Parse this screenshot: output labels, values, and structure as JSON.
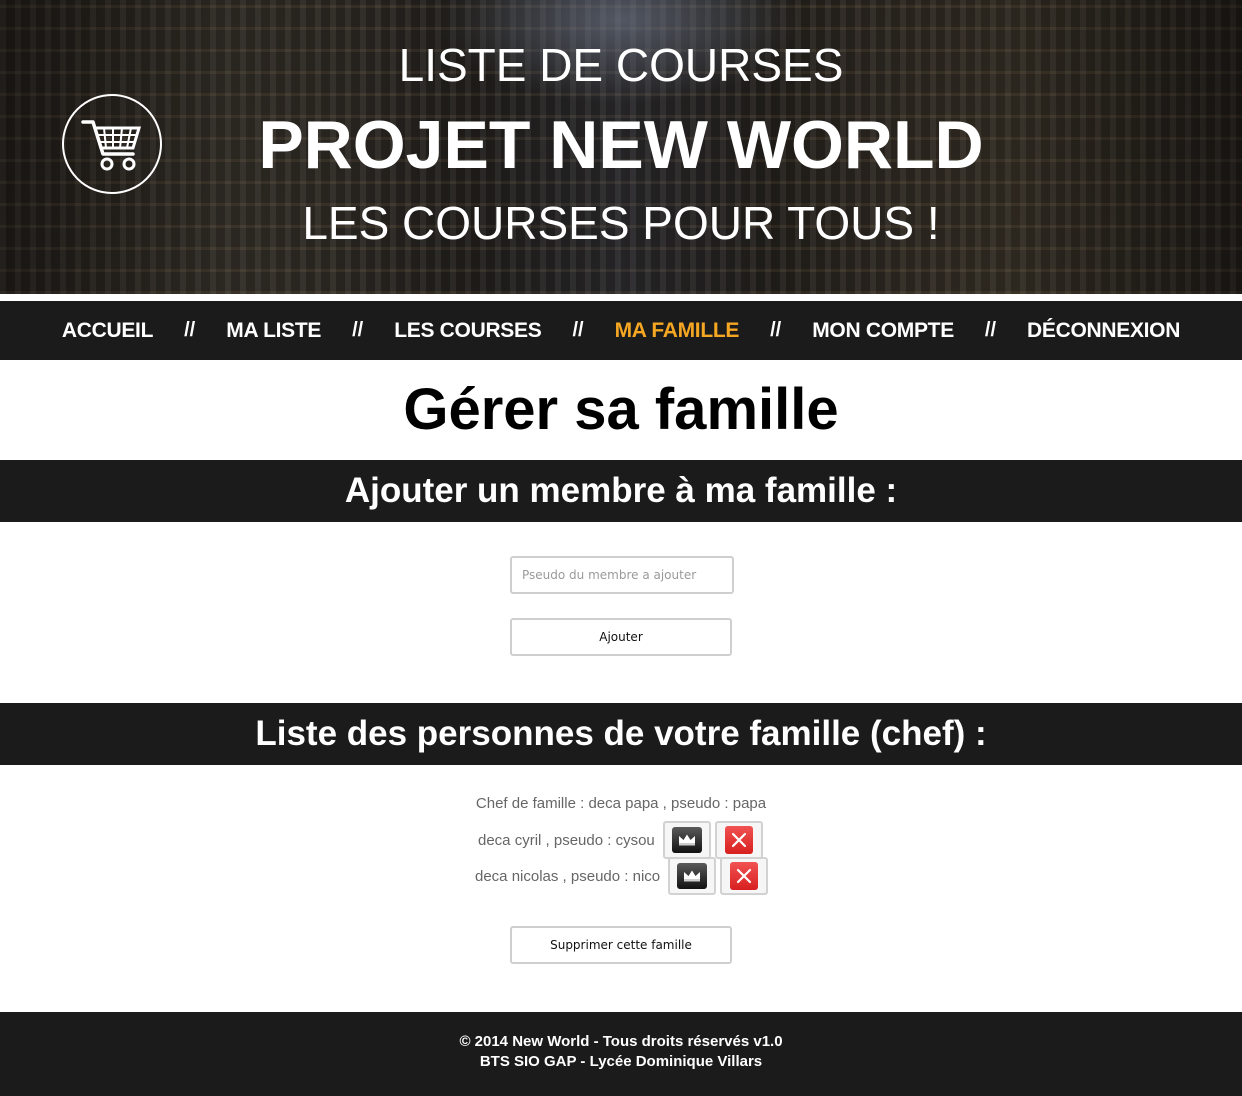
{
  "header": {
    "line1": "LISTE DE COURSES",
    "line2": "PROJET NEW WORLD",
    "line3": "LES COURSES POUR TOUS !",
    "logo_icon": "shopping-cart-icon"
  },
  "nav": {
    "items": [
      {
        "label": "ACCUEIL"
      },
      {
        "label": "MA LISTE"
      },
      {
        "label": "LES COURSES"
      },
      {
        "label": "MA FAMILLE"
      },
      {
        "label": "MON COMPTE"
      },
      {
        "label": "DÉCONNEXION"
      }
    ],
    "separator": "//",
    "active_color": "#f5a623"
  },
  "page": {
    "title": "Gérer sa famille"
  },
  "add_member": {
    "heading": "Ajouter un membre à ma famille :",
    "input_placeholder": "Pseudo du membre a ajouter",
    "input_value": "",
    "button_label": "Ajouter"
  },
  "family_list": {
    "heading": "Liste des personnes de votre famille (chef) :",
    "chef_line": "Chef de famille : deca papa , pseudo : papa",
    "members": [
      {
        "text": "deca cyril , pseudo : cysou",
        "promote_icon": "crown-icon",
        "remove_icon": "close-icon"
      },
      {
        "text": "deca nicolas , pseudo : nico",
        "promote_icon": "crown-icon",
        "remove_icon": "close-icon"
      }
    ],
    "delete_button_label": "Supprimer cette famille"
  },
  "footer": {
    "line1": "© 2014 New World - Tous droits réservés v1.0",
    "line2": "BTS SIO GAP - Lycée Dominique Villars"
  },
  "colors": {
    "dark_bar": "#1b1b1b",
    "accent": "#f5a623",
    "remove_red": "#e03030"
  }
}
